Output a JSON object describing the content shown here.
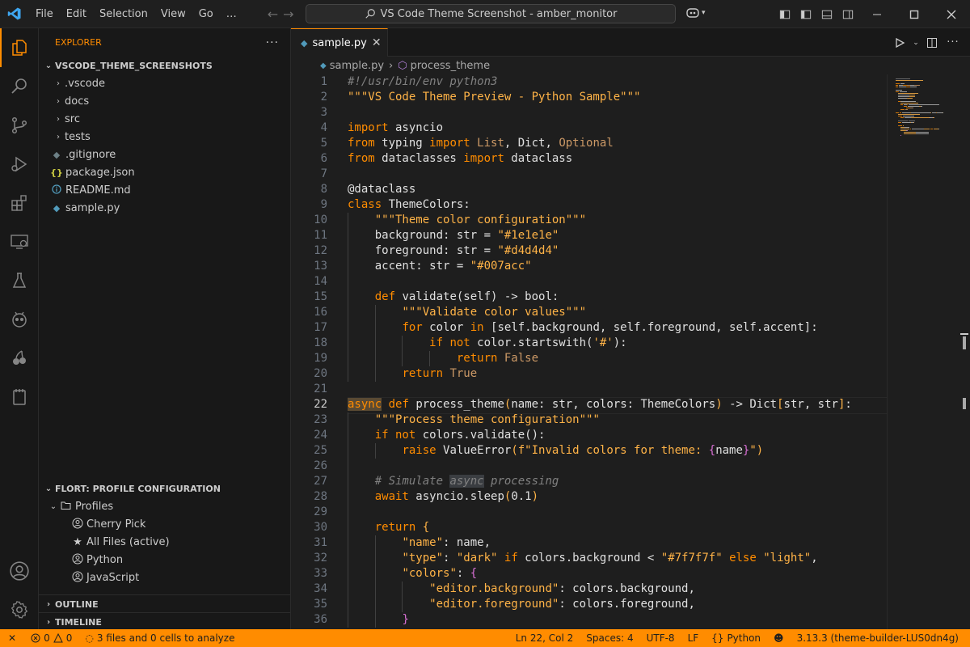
{
  "titlebar": {
    "menu": [
      "File",
      "Edit",
      "Selection",
      "View",
      "Go",
      "…"
    ],
    "search_text": "VS Code Theme Screenshot - amber_monitor"
  },
  "sidebar": {
    "explorer_title": "EXPLORER",
    "workspace": "VSCODE_THEME_SCREENSHOTS",
    "folders": [
      ".vscode",
      "docs",
      "src",
      "tests"
    ],
    "files": [
      {
        "name": ".gitignore",
        "icon": "gitignore-icon"
      },
      {
        "name": "package.json",
        "icon": "json-icon"
      },
      {
        "name": "README.md",
        "icon": "info-icon"
      },
      {
        "name": "sample.py",
        "icon": "python-icon"
      }
    ],
    "flort_title": "FLORT: PROFILE CONFIGURATION",
    "profiles_label": "Profiles",
    "profiles": [
      {
        "name": "Cherry Pick",
        "icon": "account-icon"
      },
      {
        "name": "All Files (active)",
        "icon": "star-icon"
      },
      {
        "name": "Python",
        "icon": "account-icon"
      },
      {
        "name": "JavaScript",
        "icon": "account-icon"
      }
    ],
    "outline": "OUTLINE",
    "timeline": "TIMELINE"
  },
  "editor": {
    "tab_label": "sample.py",
    "breadcrumb_file": "sample.py",
    "breadcrumb_symbol": "process_theme"
  },
  "statusbar": {
    "errors": "0",
    "warnings": "0",
    "analyze": "3 files and 0 cells to analyze",
    "position": "Ln 22, Col 2",
    "spaces": "Spaces: 4",
    "encoding": "UTF-8",
    "eol": "LF",
    "language": "Python",
    "interpreter": "3.13.3 (theme-builder-LUS0dn4g)"
  },
  "colors": {
    "accent": "#ff8c00",
    "keyword": "#ff8c00",
    "string": "#ffb347",
    "comment": "#808080"
  },
  "code": [
    {
      "n": "1",
      "t": [
        [
          "cm",
          "#!/usr/bin/env python3"
        ]
      ]
    },
    {
      "n": "2",
      "t": [
        [
          "str",
          "\"\"\"VS Code Theme Preview - Python Sample\"\"\""
        ]
      ]
    },
    {
      "n": "3",
      "t": []
    },
    {
      "n": "4",
      "t": [
        [
          "kw",
          "import"
        ],
        [
          "pl",
          " asyncio"
        ]
      ]
    },
    {
      "n": "5",
      "t": [
        [
          "kw",
          "from"
        ],
        [
          "pl",
          " typing "
        ],
        [
          "kw",
          "import"
        ],
        [
          "bi",
          " List"
        ],
        [
          "pl",
          ", Dict, "
        ],
        [
          "bi",
          "Optional"
        ]
      ]
    },
    {
      "n": "6",
      "t": [
        [
          "kw",
          "from"
        ],
        [
          "pl",
          " dataclasses "
        ],
        [
          "kw",
          "import"
        ],
        [
          "pl",
          " dataclass"
        ]
      ]
    },
    {
      "n": "7",
      "t": []
    },
    {
      "n": "8",
      "t": [
        [
          "pl",
          "@dataclass"
        ]
      ]
    },
    {
      "n": "9",
      "t": [
        [
          "kw",
          "class"
        ],
        [
          "pl",
          " ThemeColors:"
        ]
      ]
    },
    {
      "n": "10",
      "i": 1,
      "t": [
        [
          "pl",
          "    "
        ],
        [
          "str",
          "\"\"\"Theme color configuration\"\"\""
        ]
      ]
    },
    {
      "n": "11",
      "i": 1,
      "t": [
        [
          "pl",
          "    background: str = "
        ],
        [
          "str",
          "\"#1e1e1e\""
        ]
      ]
    },
    {
      "n": "12",
      "i": 1,
      "t": [
        [
          "pl",
          "    foreground: str = "
        ],
        [
          "str",
          "\"#d4d4d4\""
        ]
      ]
    },
    {
      "n": "13",
      "i": 1,
      "t": [
        [
          "pl",
          "    accent: str = "
        ],
        [
          "str",
          "\"#007acc\""
        ]
      ]
    },
    {
      "n": "14",
      "i": 1,
      "t": []
    },
    {
      "n": "15",
      "i": 1,
      "t": [
        [
          "pl",
          "    "
        ],
        [
          "kw",
          "def"
        ],
        [
          "pl",
          " validate(self) -> bool:"
        ]
      ]
    },
    {
      "n": "16",
      "i": 2,
      "t": [
        [
          "pl",
          "        "
        ],
        [
          "str",
          "\"\"\"Validate color values\"\"\""
        ]
      ]
    },
    {
      "n": "17",
      "i": 2,
      "t": [
        [
          "pl",
          "        "
        ],
        [
          "kw",
          "for"
        ],
        [
          "pl",
          " color "
        ],
        [
          "kw",
          "in"
        ],
        [
          "pl",
          " [self.background, self.foreground, self.accent]:"
        ]
      ]
    },
    {
      "n": "18",
      "i": 3,
      "t": [
        [
          "pl",
          "            "
        ],
        [
          "kw",
          "if not"
        ],
        [
          "pl",
          " color.startswith("
        ],
        [
          "str",
          "'#'"
        ],
        [
          "pl",
          "):"
        ]
      ]
    },
    {
      "n": "19",
      "i": 4,
      "t": [
        [
          "pl",
          "                "
        ],
        [
          "kw",
          "return"
        ],
        [
          "bi",
          " False"
        ]
      ]
    },
    {
      "n": "20",
      "i": 2,
      "t": [
        [
          "pl",
          "        "
        ],
        [
          "kw",
          "return"
        ],
        [
          "bi",
          " True"
        ]
      ]
    },
    {
      "n": "21",
      "t": []
    },
    {
      "n": "22",
      "cur": 1,
      "t": [
        [
          "kw hl-async",
          "async"
        ],
        [
          "pl",
          " "
        ],
        [
          "kw",
          "def"
        ],
        [
          "pl",
          " process_theme"
        ],
        [
          "br",
          "("
        ],
        [
          "pl",
          "name: str, colors: ThemeColors"
        ],
        [
          "br",
          ")"
        ],
        [
          "pl",
          " -> Dict"
        ],
        [
          "br",
          "["
        ],
        [
          "pl",
          "str, str"
        ],
        [
          "br",
          "]"
        ],
        [
          "pl",
          ":"
        ]
      ]
    },
    {
      "n": "23",
      "i": 1,
      "t": [
        [
          "pl",
          "    "
        ],
        [
          "str",
          "\"\"\"Process theme configuration\"\"\""
        ]
      ]
    },
    {
      "n": "24",
      "i": 1,
      "t": [
        [
          "pl",
          "    "
        ],
        [
          "kw",
          "if not"
        ],
        [
          "pl",
          " colors.validate():"
        ]
      ]
    },
    {
      "n": "25",
      "i": 2,
      "t": [
        [
          "pl",
          "        "
        ],
        [
          "kw",
          "raise"
        ],
        [
          "pl",
          " ValueError"
        ],
        [
          "br",
          "("
        ],
        [
          "str",
          "f\"Invalid colors for theme: "
        ],
        [
          "br2",
          "{"
        ],
        [
          "pl",
          "name"
        ],
        [
          "br2",
          "}"
        ],
        [
          "str",
          "\""
        ],
        [
          "br",
          ")"
        ]
      ]
    },
    {
      "n": "26",
      "i": 1,
      "t": []
    },
    {
      "n": "27",
      "i": 1,
      "t": [
        [
          "pl",
          "    "
        ],
        [
          "cm",
          "# Simulate "
        ],
        [
          "cm hl-word",
          "async"
        ],
        [
          "cm",
          " processing"
        ]
      ]
    },
    {
      "n": "28",
      "i": 1,
      "t": [
        [
          "pl",
          "    "
        ],
        [
          "kw",
          "await"
        ],
        [
          "pl",
          " asyncio.sleep"
        ],
        [
          "br",
          "("
        ],
        [
          "pl",
          "0.1"
        ],
        [
          "br",
          ")"
        ]
      ]
    },
    {
      "n": "29",
      "i": 1,
      "t": []
    },
    {
      "n": "30",
      "i": 1,
      "t": [
        [
          "pl",
          "    "
        ],
        [
          "kw",
          "return"
        ],
        [
          "pl",
          " "
        ],
        [
          "br",
          "{"
        ]
      ]
    },
    {
      "n": "31",
      "i": 2,
      "t": [
        [
          "pl",
          "        "
        ],
        [
          "str",
          "\"name\""
        ],
        [
          "pl",
          ": name,"
        ]
      ]
    },
    {
      "n": "32",
      "i": 2,
      "t": [
        [
          "pl",
          "        "
        ],
        [
          "str",
          "\"type\""
        ],
        [
          "pl",
          ": "
        ],
        [
          "str",
          "\"dark\""
        ],
        [
          "pl",
          " "
        ],
        [
          "kw",
          "if"
        ],
        [
          "pl",
          " colors.background < "
        ],
        [
          "str",
          "\"#7f7f7f\""
        ],
        [
          "pl",
          " "
        ],
        [
          "kw",
          "else"
        ],
        [
          "pl",
          " "
        ],
        [
          "str",
          "\"light\""
        ],
        [
          "pl",
          ","
        ]
      ]
    },
    {
      "n": "33",
      "i": 2,
      "t": [
        [
          "pl",
          "        "
        ],
        [
          "str",
          "\"colors\""
        ],
        [
          "pl",
          ": "
        ],
        [
          "br2",
          "{"
        ]
      ]
    },
    {
      "n": "34",
      "i": 3,
      "t": [
        [
          "pl",
          "            "
        ],
        [
          "str",
          "\"editor.background\""
        ],
        [
          "pl",
          ": colors.background,"
        ]
      ]
    },
    {
      "n": "35",
      "i": 3,
      "t": [
        [
          "pl",
          "            "
        ],
        [
          "str",
          "\"editor.foreground\""
        ],
        [
          "pl",
          ": colors.foreground,"
        ]
      ]
    },
    {
      "n": "36",
      "i": 2,
      "t": [
        [
          "pl",
          "        "
        ],
        [
          "br2",
          "}"
        ]
      ]
    }
  ]
}
